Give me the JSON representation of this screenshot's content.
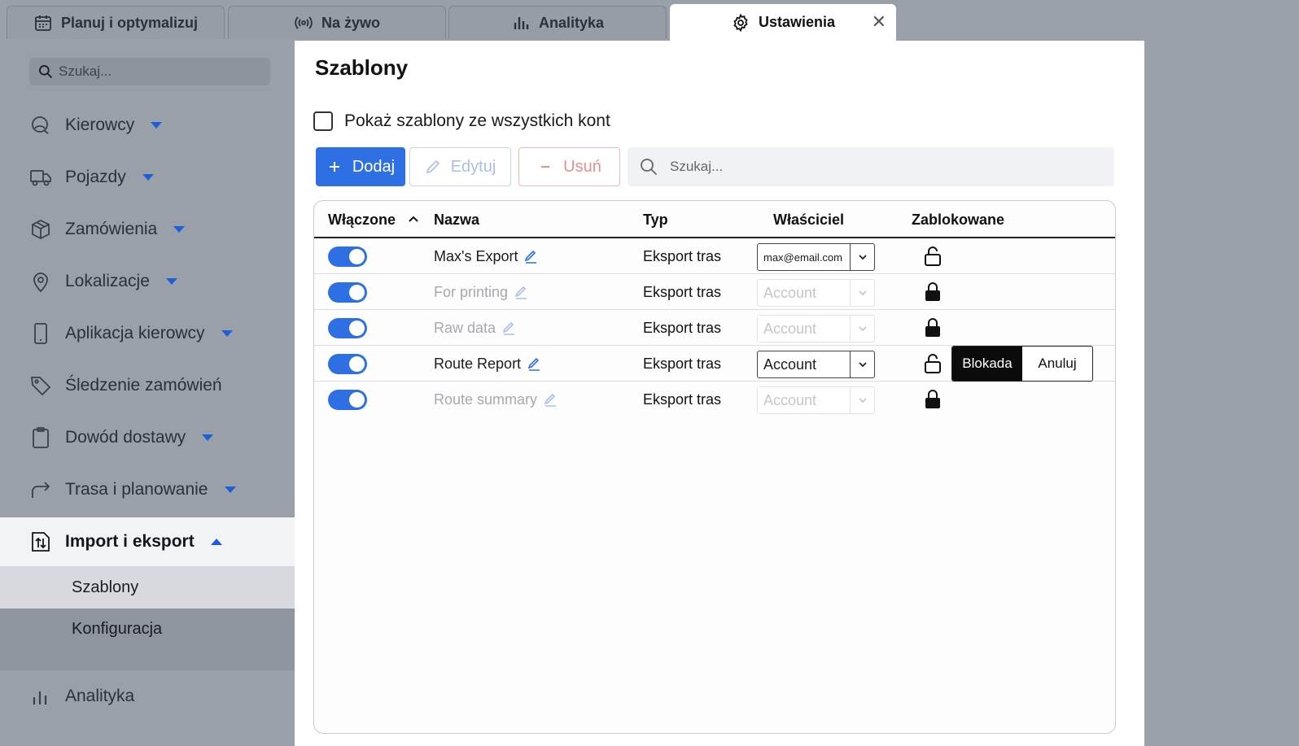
{
  "tabs": [
    {
      "label": "Planuj i optymalizuj",
      "icon": "calendar-icon"
    },
    {
      "label": "Na żywo",
      "icon": "broadcast-icon"
    },
    {
      "label": "Analityka",
      "icon": "bar-chart-icon"
    },
    {
      "label": "Ustawienia",
      "icon": "gear-icon",
      "active": true,
      "close": "✕"
    }
  ],
  "sidebar": {
    "search_placeholder": "Szukaj...",
    "items": [
      {
        "label": "Kierowcy",
        "icon": "drivers-icon"
      },
      {
        "label": "Pojazdy",
        "icon": "truck-icon"
      },
      {
        "label": "Zamówienia",
        "icon": "box-icon"
      },
      {
        "label": "Lokalizacje",
        "icon": "map-pin-icon"
      },
      {
        "label": "Aplikacja kierowcy",
        "icon": "phone-icon"
      },
      {
        "label": "Śledzenie zamówień",
        "icon": "tag-icon"
      },
      {
        "label": "Dowód dostawy",
        "icon": "clipboard-icon"
      },
      {
        "label": "Trasa i planowanie",
        "icon": "route-arrow-icon"
      },
      {
        "label": "Import i eksport",
        "icon": "import-export-icon",
        "open": true
      },
      {
        "label": "Analityka",
        "icon": "bar-chart-icon"
      }
    ],
    "subitems": [
      {
        "label": "Szablony",
        "active": true
      },
      {
        "label": "Konfiguracja"
      }
    ]
  },
  "main": {
    "title": "Szablony",
    "show_all_label": "Pokaż szablony ze wszystkich kont",
    "show_all_checked": false,
    "buttons": {
      "add": "Dodaj",
      "edit": "Edytuj",
      "delete": "Usuń"
    },
    "search_placeholder": "Szukaj...",
    "columns": [
      "Włączone",
      "Nazwa",
      "Typ",
      "Właściciel",
      "Zablokowane"
    ],
    "rows": [
      {
        "enabled": true,
        "name": "Max's Export",
        "type": "Eksport tras",
        "owner": "max@email.com",
        "locked": false,
        "dim": false
      },
      {
        "enabled": true,
        "name": "For printing",
        "type": "Eksport tras",
        "owner": "Account",
        "locked": true,
        "dim": true
      },
      {
        "enabled": true,
        "name": "Raw data",
        "type": "Eksport tras",
        "owner": "Account",
        "locked": true,
        "dim": true
      },
      {
        "enabled": true,
        "name": "Route Report",
        "type": "Eksport tras",
        "owner": "Account",
        "locked": false,
        "dim": false
      },
      {
        "enabled": true,
        "name": "Route summary",
        "type": "Eksport tras",
        "owner": "Account",
        "locked": true,
        "dim": true
      }
    ],
    "confirm_popup": {
      "confirm": "Blokada",
      "cancel": "Anuluj"
    }
  },
  "colors": {
    "accent": "#2f6fe4",
    "danger": "#ee8c8c",
    "sidebar_bg": "#9aa0a9"
  }
}
